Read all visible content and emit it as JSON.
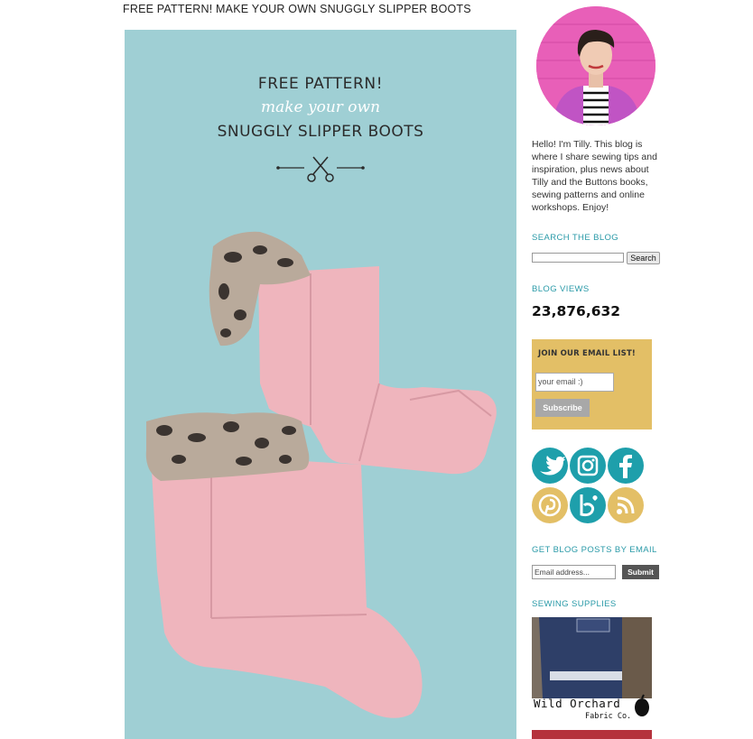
{
  "post": {
    "title": "FREE PATTERN! MAKE YOUR OWN SNUGGLY SLIPPER BOOTS"
  },
  "hero": {
    "line1": "FREE PATTERN!",
    "line2": "make your own",
    "line3": "SNUGGLY SLIPPER BOOTS",
    "icon": "scissors-icon",
    "colors": {
      "background": "#9fcfd4",
      "boot": "#efb5bd",
      "fur": "#b9aa9b"
    }
  },
  "sidebar": {
    "avatar_icon": "author-avatar",
    "bio": "Hello! I'm Tilly. This blog is where I share sewing tips and inspiration, plus news about Tilly and the Buttons books, sewing patterns and online workshops. Enjoy!",
    "search": {
      "title": "SEARCH THE BLOG",
      "button": "Search",
      "value": ""
    },
    "views": {
      "title": "BLOG VIEWS",
      "count": "23,876,632"
    },
    "email_list": {
      "title": "JOIN OUR EMAIL LIST!",
      "placeholder": "your email :)",
      "button": "Subscribe",
      "color": "#e3bf66"
    },
    "social": [
      {
        "name": "twitter-icon",
        "color": "#1e9fab"
      },
      {
        "name": "instagram-icon",
        "color": "#1e9fab"
      },
      {
        "name": "facebook-icon",
        "color": "#1e9fab"
      },
      {
        "name": "pinterest-icon",
        "color": "#e3bf66"
      },
      {
        "name": "bloglovin-icon",
        "color": "#1e9fab"
      },
      {
        "name": "rss-icon",
        "color": "#e3bf66"
      }
    ],
    "posts_by_email": {
      "title": "GET BLOG POSTS BY EMAIL",
      "placeholder": "Email address...",
      "button": "Submit"
    },
    "supplies": {
      "title": "SEWING SUPPLIES",
      "brand": "Wild Orchard",
      "brand_sub": "Fabric Co."
    }
  }
}
